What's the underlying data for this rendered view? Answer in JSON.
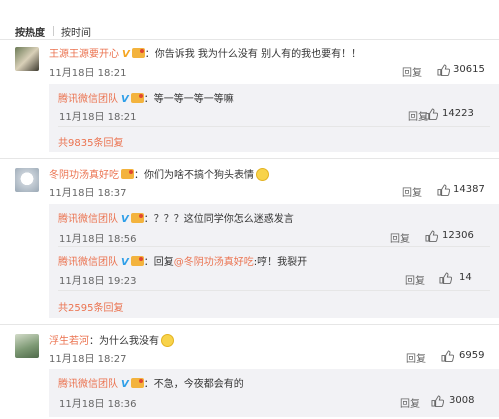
{
  "sort": {
    "hot": "按热度",
    "time": "按时间"
  },
  "colors": {
    "name": "#eb7350",
    "bg_sub": "#f2f2f5"
  },
  "comments": [
    {
      "user": "王源王源要开心",
      "text": "：你告诉我 我为什么没有 别人有的我也要有！！",
      "time": "11月18日 18:21",
      "reply": "回复",
      "likes": "30615",
      "replies": [
        {
          "user": "腾讯微信团队",
          "text": "：等一等一等一等嘛",
          "time": "11月18日 18:21",
          "reply": "回复",
          "likes": "14223"
        }
      ],
      "more": "共9835条回复"
    },
    {
      "user": "冬阴功汤真好吃",
      "text": "：你们为啥不搞个狗头表情",
      "time": "11月18日 18:37",
      "reply": "回复",
      "likes": "14387",
      "replies": [
        {
          "user": "腾讯微信团队",
          "text": "：？？？这位同学你怎么迷惑发言",
          "time": "11月18日 18:56",
          "reply": "回复",
          "likes": "12306"
        },
        {
          "user": "腾讯微信团队",
          "text_prefix": "：回复",
          "mention": "@冬阴功汤真好吃",
          "text": ":哼！我裂开",
          "time": "11月18日 19:23",
          "reply": "回复",
          "likes": "14"
        }
      ],
      "more": "共2595条回复"
    },
    {
      "user": "浮生若河",
      "text": "：为什么我没有",
      "time": "11月18日 18:27",
      "reply": "回复",
      "likes": "6959",
      "replies": [
        {
          "user": "腾讯微信团队",
          "text": "：不急，今夜都会有的",
          "time": "11月18日 18:36",
          "reply": "回复",
          "likes": "3008"
        }
      ]
    }
  ]
}
